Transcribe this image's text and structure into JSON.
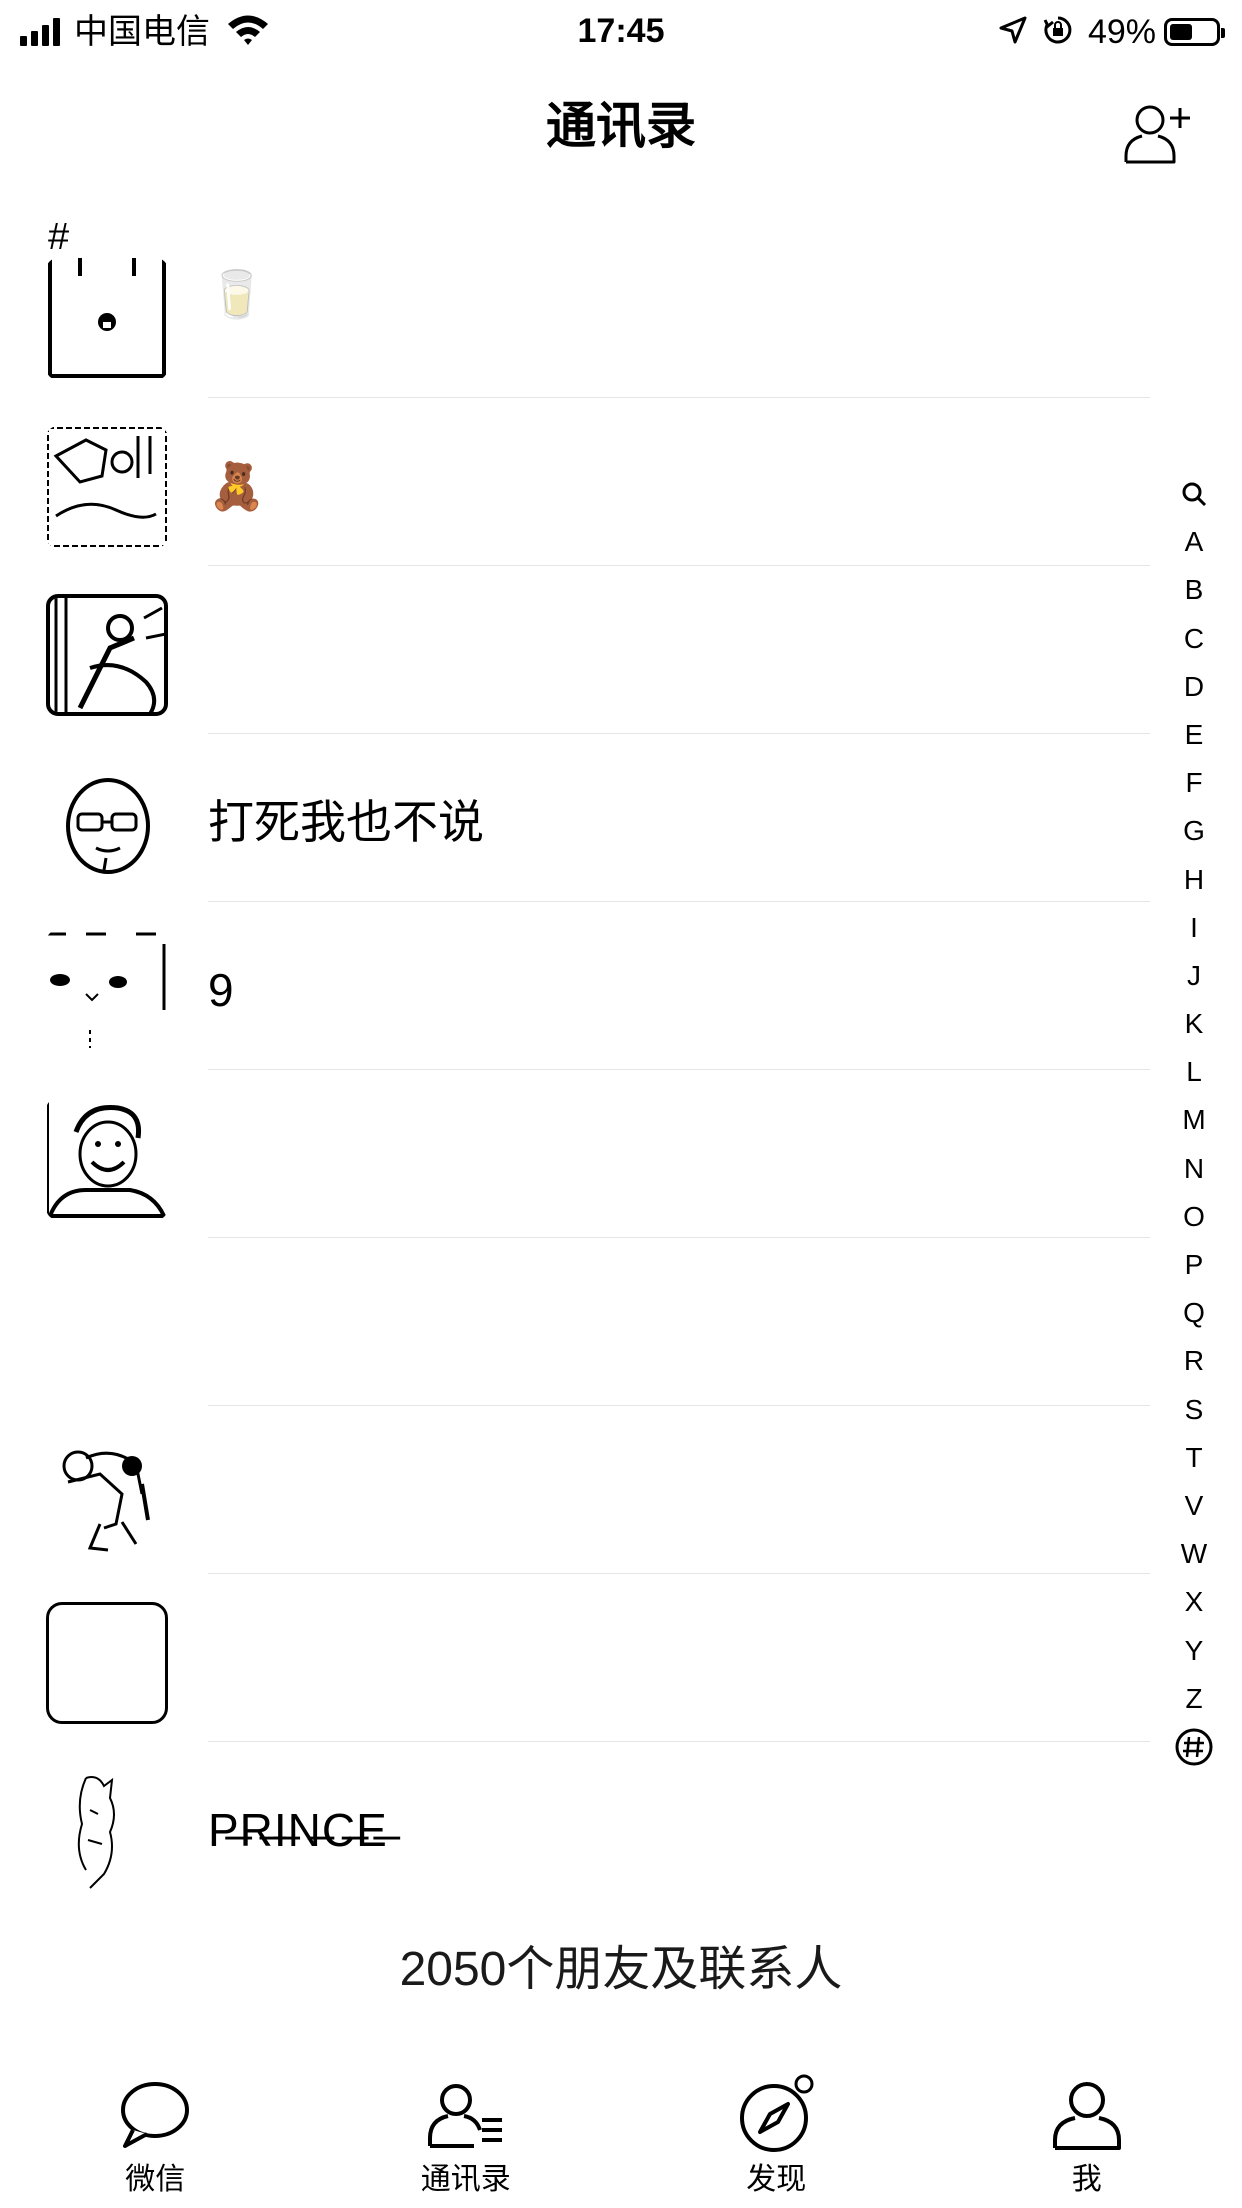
{
  "status_bar": {
    "carrier": "中国电信",
    "time": "17:45",
    "battery_percent": "49%",
    "battery_level": 0.49,
    "icons": [
      "signal-icon",
      "wifi-icon",
      "location-arrow-icon",
      "orientation-lock-icon",
      "battery-icon"
    ]
  },
  "nav": {
    "title": "通讯录",
    "add_icon": "add-friend-icon"
  },
  "section": {
    "header": "#"
  },
  "contacts": [
    {
      "name": "🥛",
      "avatar": "drawn-box-avatar"
    },
    {
      "name": "🧸",
      "avatar": "photo-avatar"
    },
    {
      "name": "",
      "avatar": "photo-avatar"
    },
    {
      "name": "打死我也不说",
      "avatar": "cartoon-face-avatar"
    },
    {
      "name": "9",
      "avatar": "cat-avatar"
    },
    {
      "name": "",
      "avatar": "smiling-man-avatar"
    },
    {
      "name": "",
      "avatar": "blank-avatar"
    },
    {
      "name": "",
      "avatar": "cartoon-figure-avatar"
    },
    {
      "name": "",
      "avatar": "empty-frame-avatar"
    },
    {
      "name": "P̶R̶I̶N̶C̶E̶",
      "avatar": "sketch-avatar"
    }
  ],
  "index_bar": {
    "letters": [
      "A",
      "B",
      "C",
      "D",
      "E",
      "F",
      "G",
      "H",
      "I",
      "J",
      "K",
      "L",
      "M",
      "N",
      "O",
      "P",
      "Q",
      "R",
      "S",
      "T",
      "V",
      "W",
      "X",
      "Y",
      "Z"
    ],
    "search_icon": "search-icon",
    "hash_icon": "hash-circle-icon"
  },
  "footer": {
    "count_text": "2050个朋友及联系人"
  },
  "tabs": [
    {
      "label": "微信",
      "icon": "chat-bubble-icon"
    },
    {
      "label": "通讯录",
      "icon": "contacts-icon"
    },
    {
      "label": "发现",
      "icon": "compass-icon"
    },
    {
      "label": "我",
      "icon": "person-icon"
    }
  ]
}
